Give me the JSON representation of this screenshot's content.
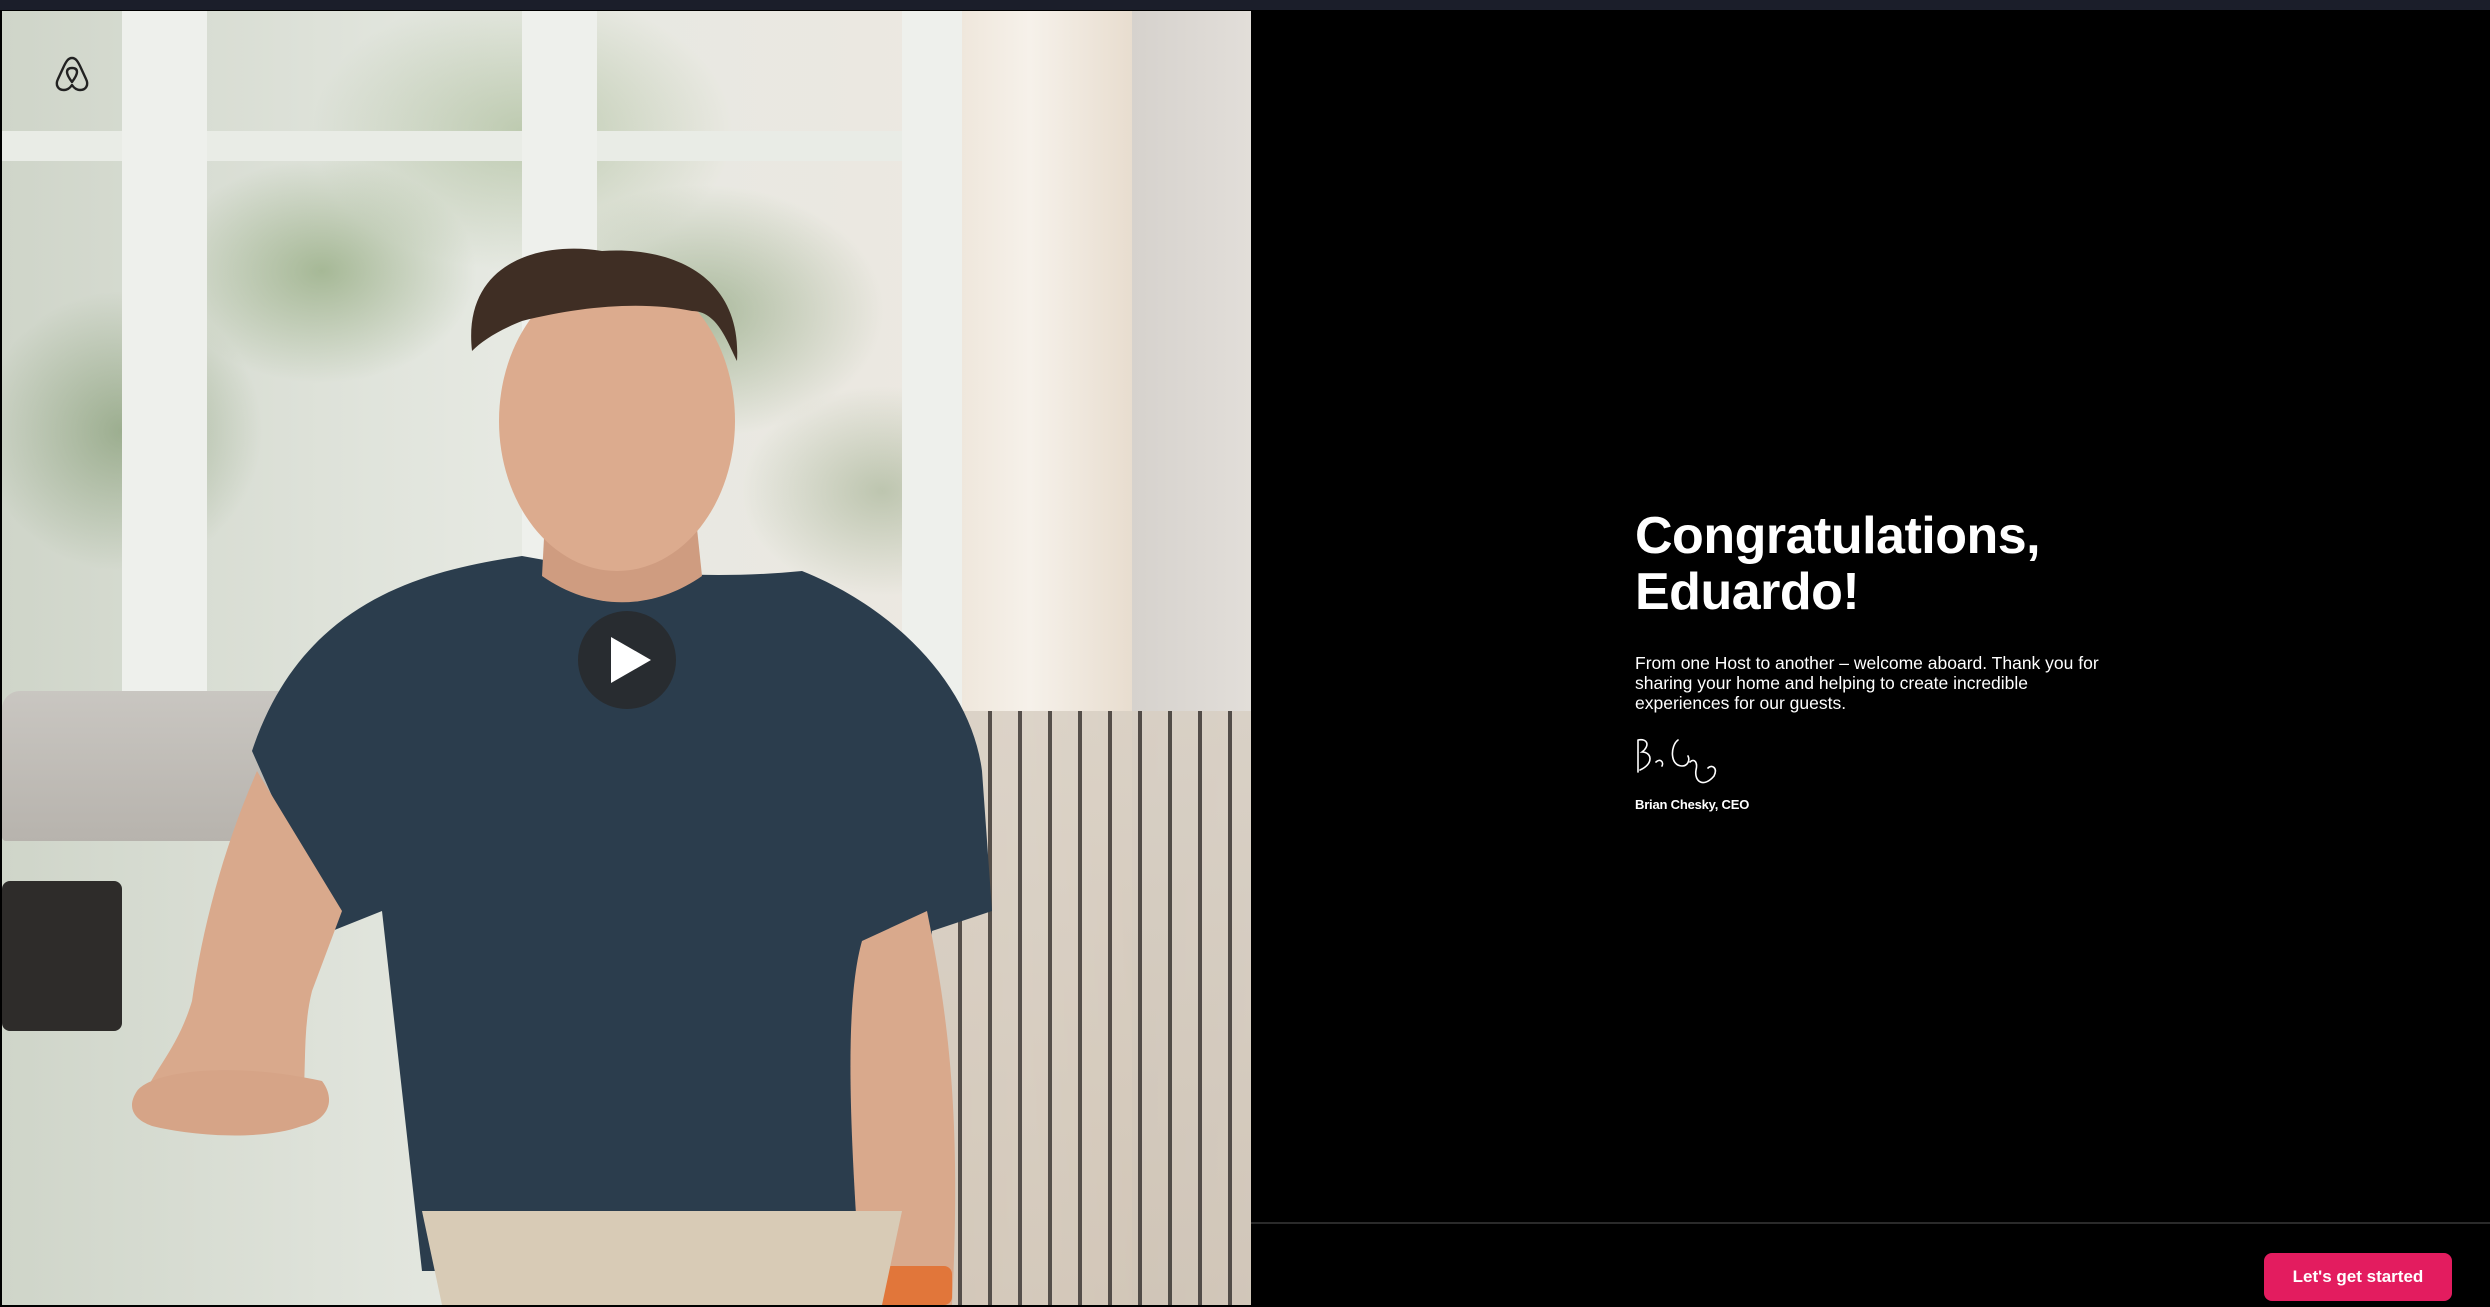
{
  "video": {
    "play_icon": "play-icon",
    "logo_icon": "airbnb-logo-icon"
  },
  "welcome": {
    "headline": "Congratulations, Eduardo!",
    "message": "From one Host to another – welcome aboard. Thank you for sharing your home and helping to create incredible experiences for our guests.",
    "signature_icon": "handwritten-signature",
    "signer": "Brian Chesky, CEO"
  },
  "footer": {
    "cta_label": "Let's get started"
  },
  "colors": {
    "accent": "#e31c5f",
    "background": "#000000",
    "text": "#ffffff"
  }
}
